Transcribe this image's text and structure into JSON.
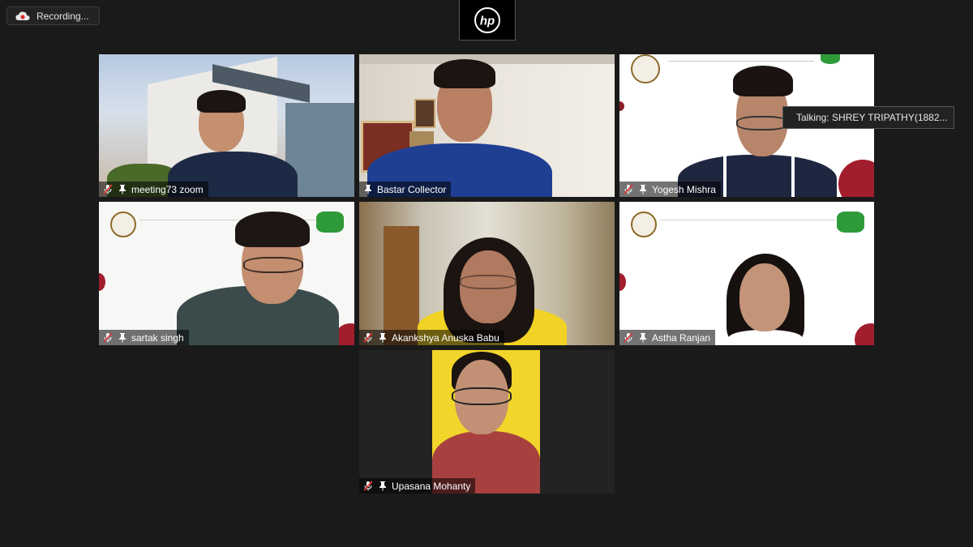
{
  "recording": {
    "label": "Recording..."
  },
  "logo": {
    "text": "hp"
  },
  "talking_indicator": "Talking:  SHREY  TRIPATHY(1882...",
  "participants": [
    {
      "name": "meeting73 zoom",
      "muted": true
    },
    {
      "name": "Bastar Collector",
      "muted": false
    },
    {
      "name": "Yogesh Mishra",
      "muted": true
    },
    {
      "name": "sartak singh",
      "muted": true
    },
    {
      "name": "Akankshya Anuska Babu",
      "muted": true
    },
    {
      "name": "Astha Ranjan",
      "muted": true
    },
    {
      "name": "Upasana Mohanty",
      "muted": true
    }
  ],
  "colors": {
    "background": "#1a1a1a",
    "muted_icon": "#e03a3a",
    "name_tag_text": "#ffffff"
  }
}
